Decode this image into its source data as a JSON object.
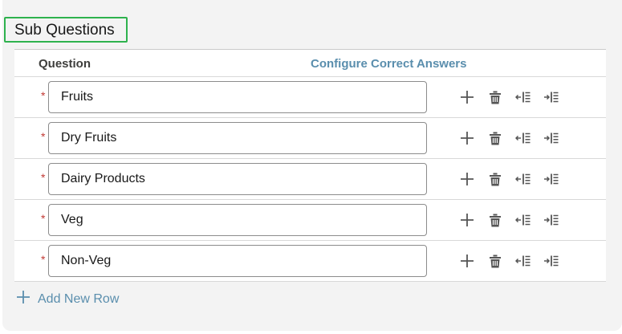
{
  "section": {
    "title": "Sub Questions"
  },
  "table": {
    "headers": {
      "question": "Question",
      "configure_answers": "Configure Correct Answers"
    },
    "rows": [
      {
        "value": "Fruits",
        "required_mark": "*"
      },
      {
        "value": "Dry Fruits",
        "required_mark": "*"
      },
      {
        "value": "Dairy Products",
        "required_mark": "*"
      },
      {
        "value": "Veg",
        "required_mark": "*"
      },
      {
        "value": "Non-Veg",
        "required_mark": "*"
      }
    ],
    "row_actions": [
      "plus-icon",
      "trash-icon",
      "outdent-icon",
      "indent-icon"
    ]
  },
  "footer": {
    "add_row_label": "Add New Row"
  },
  "colors": {
    "accent_link": "#5a8ead",
    "required": "#c23934",
    "highlight_border": "#2eb24e",
    "icon": "#555555"
  }
}
